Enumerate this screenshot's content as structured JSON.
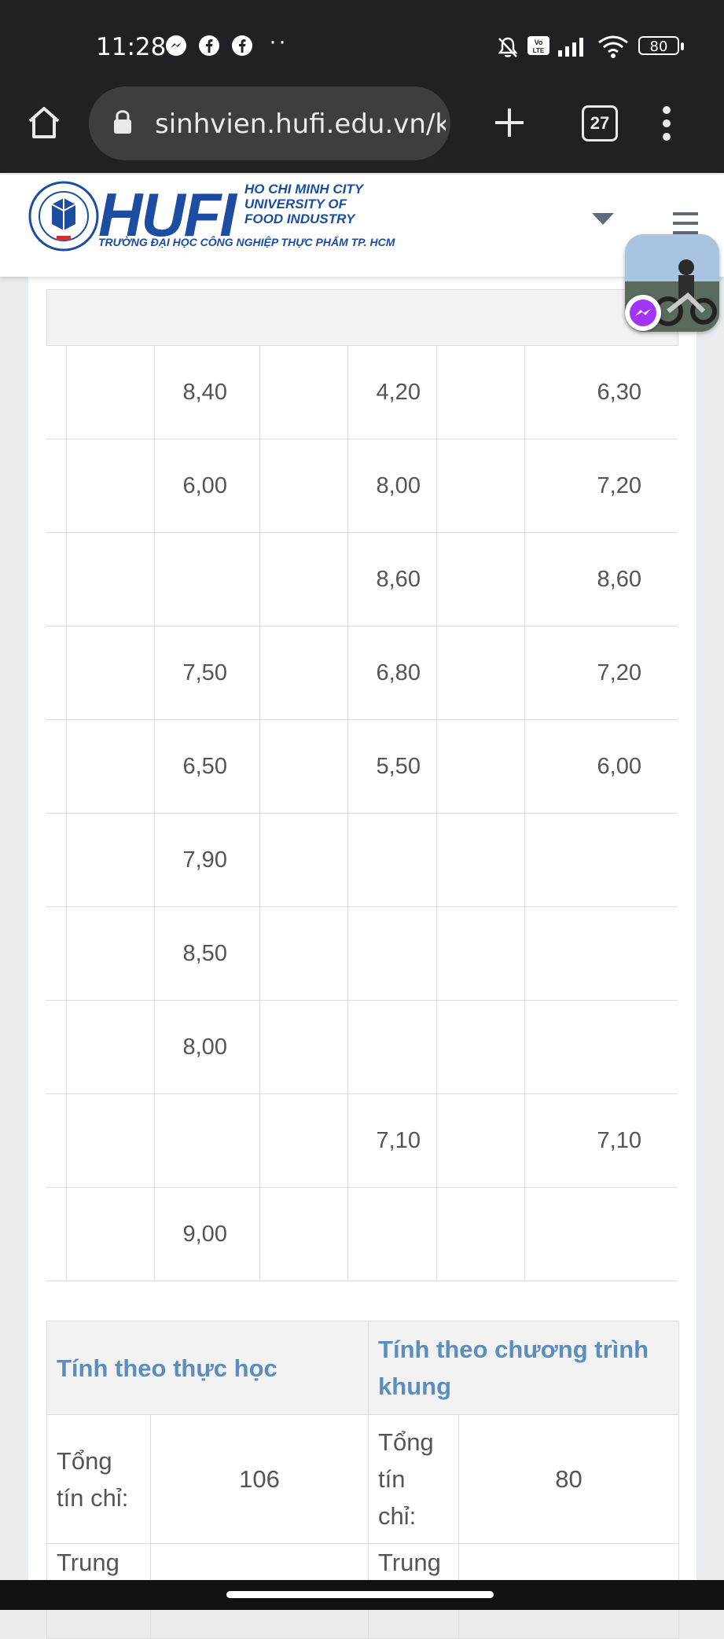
{
  "status_bar": {
    "time": "11:28",
    "battery": "80"
  },
  "browser": {
    "url": "sinhvien.hufi.edu.vn/k",
    "tab_count": "27"
  },
  "site": {
    "logo_main": "HUFI",
    "logo_line1": "HO CHI MINH CITY",
    "logo_line2": "UNIVERSITY OF",
    "logo_line3": "FOOD INDUSTRY",
    "logo_vn": "TRƯỜNG ĐẠI HỌC CÔNG NGHIỆP THỰC PHẨM TP. HCM"
  },
  "grades_rows": [
    [
      "",
      "8,40",
      "",
      "4,20",
      "",
      "6,30"
    ],
    [
      "",
      "6,00",
      "",
      "8,00",
      "",
      "7,20"
    ],
    [
      "",
      "",
      "",
      "8,60",
      "",
      "8,60"
    ],
    [
      "",
      "7,50",
      "",
      "6,80",
      "",
      "7,20"
    ],
    [
      "",
      "6,50",
      "",
      "5,50",
      "",
      "6,00"
    ],
    [
      "",
      "7,90",
      "",
      "",
      "",
      ""
    ],
    [
      "",
      "8,50",
      "",
      "",
      "",
      ""
    ],
    [
      "",
      "8,00",
      "",
      "",
      "",
      ""
    ],
    [
      "",
      "",
      "",
      "7,10",
      "",
      "7,10"
    ],
    [
      "",
      "9,00",
      "",
      "",
      "",
      ""
    ]
  ],
  "summary": {
    "col1_header": "Tính theo thực học",
    "col2_header": "Tính theo chương trình khung",
    "row1_label_a": "Tổng tín chỉ:",
    "row1_value_a": "106",
    "row1_label_b": "Tổng tín chỉ:",
    "row1_value_b": "80",
    "row2_label_a": "Trung",
    "row2_label_b": "Trung"
  },
  "colors": {
    "brand_blue": "#1c4da1",
    "header_link_blue": "#5b8dbd"
  }
}
